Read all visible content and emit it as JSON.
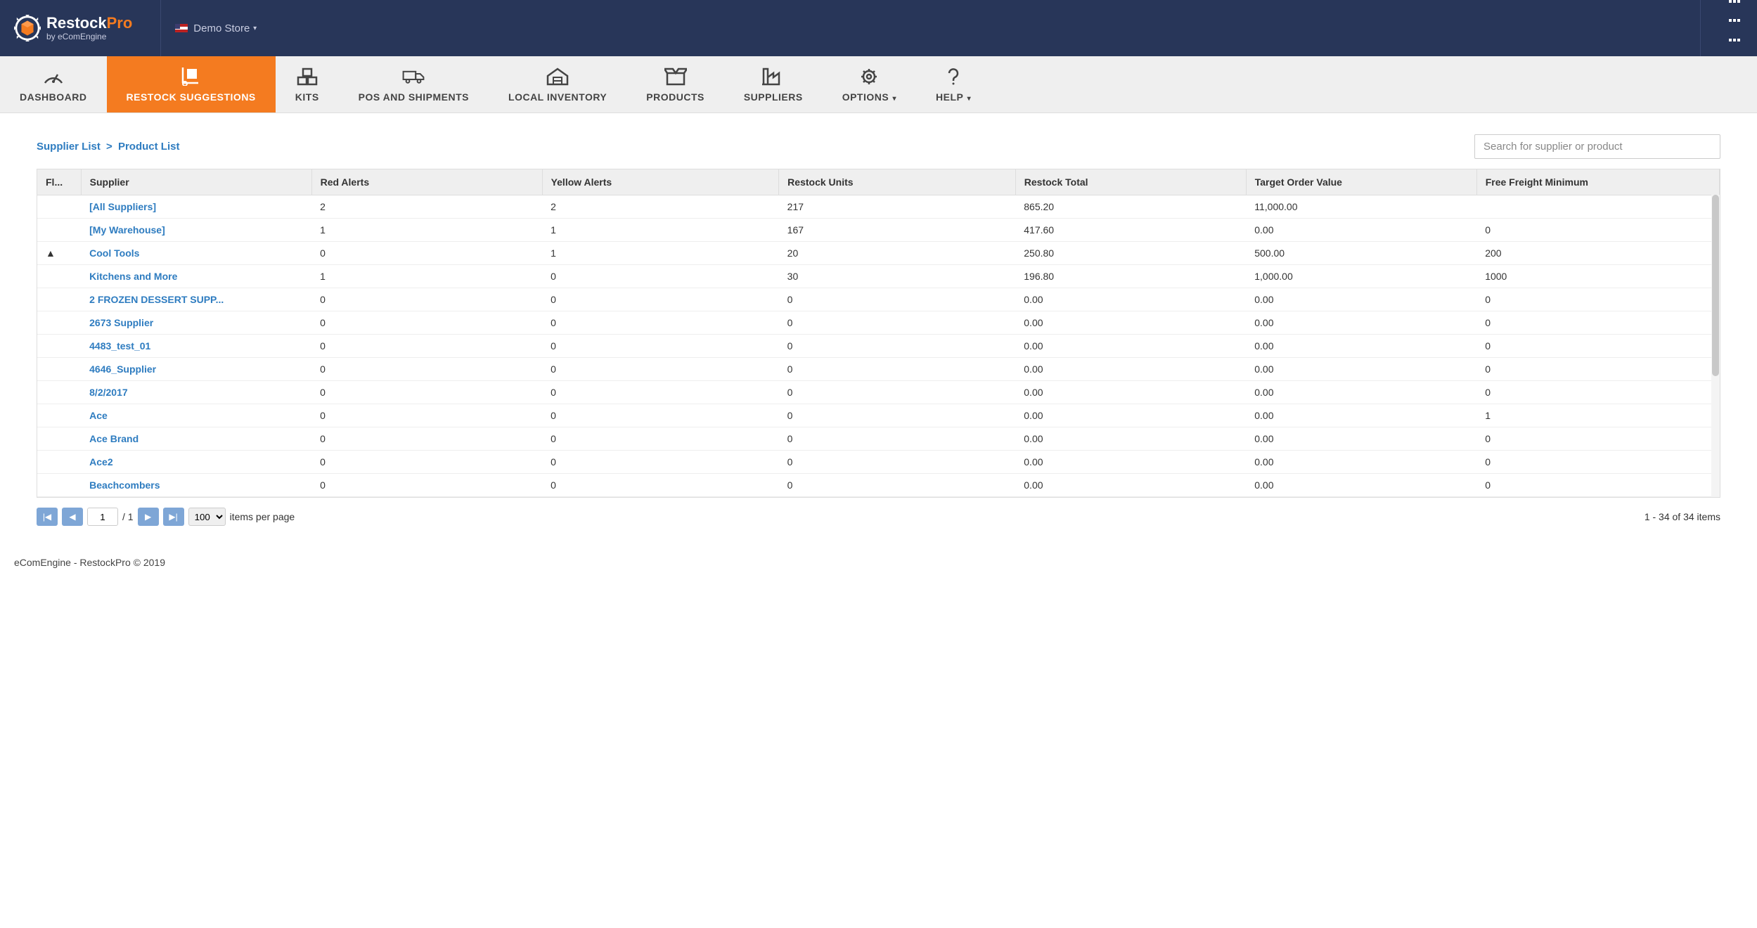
{
  "header": {
    "brand_left": "Restock",
    "brand_right": "Pro",
    "brand_sub": "by eComEngine",
    "store_label": "Demo Store"
  },
  "nav": {
    "dashboard": "DASHBOARD",
    "restock": "RESTOCK SUGGESTIONS",
    "kits": "KITS",
    "pos": "POS AND SHIPMENTS",
    "local": "LOCAL INVENTORY",
    "products": "PRODUCTS",
    "suppliers": "SUPPLIERS",
    "options": "OPTIONS",
    "help": "HELP"
  },
  "breadcrumb": {
    "a": "Supplier List",
    "b": "Product List"
  },
  "search": {
    "placeholder": "Search for supplier or product"
  },
  "table": {
    "headers": {
      "flag": "Fl...",
      "supplier": "Supplier",
      "red": "Red Alerts",
      "yellow": "Yellow Alerts",
      "units": "Restock Units",
      "total": "Restock Total",
      "target": "Target Order Value",
      "freight": "Free Freight Minimum"
    },
    "rows": [
      {
        "flag": "",
        "supplier": "[All Suppliers]",
        "red": "2",
        "yellow": "2",
        "units": "217",
        "total": "865.20",
        "target": "11,000.00",
        "freight": ""
      },
      {
        "flag": "",
        "supplier": "[My Warehouse]",
        "red": "1",
        "yellow": "1",
        "units": "167",
        "total": "417.60",
        "target": "0.00",
        "freight": "0"
      },
      {
        "flag": "warn",
        "supplier": "Cool Tools",
        "red": "0",
        "yellow": "1",
        "units": "20",
        "total": "250.80",
        "target": "500.00",
        "freight": "200"
      },
      {
        "flag": "",
        "supplier": "Kitchens and More",
        "red": "1",
        "yellow": "0",
        "units": "30",
        "total": "196.80",
        "target": "1,000.00",
        "freight": "1000"
      },
      {
        "flag": "",
        "supplier": "2 FROZEN DESSERT SUPP...",
        "red": "0",
        "yellow": "0",
        "units": "0",
        "total": "0.00",
        "target": "0.00",
        "freight": "0"
      },
      {
        "flag": "",
        "supplier": "2673 Supplier",
        "red": "0",
        "yellow": "0",
        "units": "0",
        "total": "0.00",
        "target": "0.00",
        "freight": "0"
      },
      {
        "flag": "",
        "supplier": "4483_test_01",
        "red": "0",
        "yellow": "0",
        "units": "0",
        "total": "0.00",
        "target": "0.00",
        "freight": "0"
      },
      {
        "flag": "",
        "supplier": "4646_Supplier",
        "red": "0",
        "yellow": "0",
        "units": "0",
        "total": "0.00",
        "target": "0.00",
        "freight": "0"
      },
      {
        "flag": "",
        "supplier": "8/2/2017",
        "red": "0",
        "yellow": "0",
        "units": "0",
        "total": "0.00",
        "target": "0.00",
        "freight": "0"
      },
      {
        "flag": "",
        "supplier": "Ace",
        "red": "0",
        "yellow": "0",
        "units": "0",
        "total": "0.00",
        "target": "0.00",
        "freight": "1"
      },
      {
        "flag": "",
        "supplier": "Ace Brand",
        "red": "0",
        "yellow": "0",
        "units": "0",
        "total": "0.00",
        "target": "0.00",
        "freight": "0"
      },
      {
        "flag": "",
        "supplier": "Ace2",
        "red": "0",
        "yellow": "0",
        "units": "0",
        "total": "0.00",
        "target": "0.00",
        "freight": "0"
      },
      {
        "flag": "",
        "supplier": "Beachcombers",
        "red": "0",
        "yellow": "0",
        "units": "0",
        "total": "0.00",
        "target": "0.00",
        "freight": "0"
      }
    ]
  },
  "pager": {
    "page": "1",
    "total_pages": "/ 1",
    "page_size": "100",
    "per_page_label": "items per page",
    "info": "1 - 34 of 34 items"
  },
  "footer": "eComEngine - RestockPro © 2019"
}
